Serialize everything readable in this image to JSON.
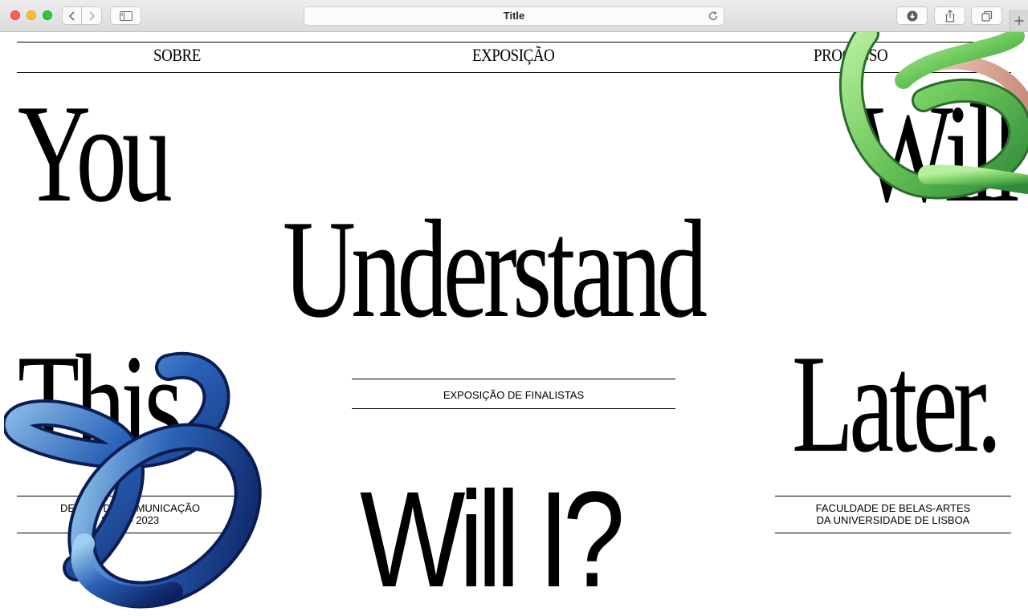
{
  "browser": {
    "title": "Title",
    "icons": [
      "chevron-left-icon",
      "chevron-right-icon",
      "sidebar-icon",
      "reload-icon",
      "download-icon",
      "share-icon",
      "tabs-icon",
      "plus-icon"
    ]
  },
  "nav": {
    "items": [
      {
        "label": "SOBRE"
      },
      {
        "label": "EXPOSIÇÃO"
      },
      {
        "label": "PROCESSO"
      }
    ]
  },
  "headline": {
    "word1": "You",
    "word2": "Will",
    "word3": "Understand",
    "word4": "This",
    "word5": "Later.",
    "word6": "Will I?"
  },
  "center_label": "EXPOSIÇÃO DE FINALISTAS",
  "left_block": {
    "line1": "DESIGN DE COMUNICAÇÃO",
    "line2": "2020 – 2023"
  },
  "right_block": {
    "line1": "FACULDADE DE BELAS-ARTES",
    "line2": "DA UNIVERSIDADE DE LISBOA"
  },
  "colors": {
    "text": "#000000",
    "background": "#ffffff",
    "blue_ribbon": "#1b3f8f",
    "green_ribbon": "#7bd06a",
    "pink_ribbon": "#e8b9a6"
  }
}
